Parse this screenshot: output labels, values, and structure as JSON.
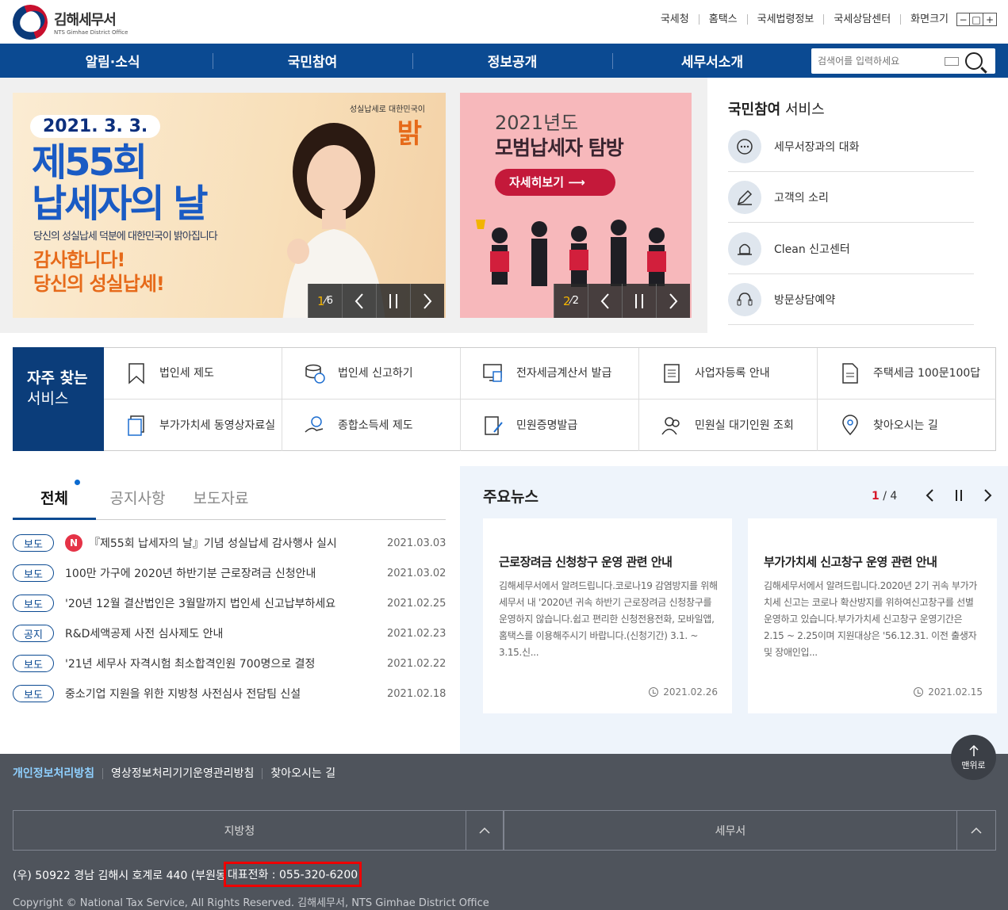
{
  "header": {
    "logo_title": "김해세무서",
    "logo_sub": "NTS Gimhae District Office",
    "util_links": [
      "국세청",
      "홈택스",
      "국세법령정보",
      "국세상담센터",
      "화면크기"
    ],
    "size_controls": [
      "−",
      "□",
      "+"
    ]
  },
  "nav": {
    "items": [
      "알림·소식",
      "국민참여",
      "정보공개",
      "세무서소개"
    ],
    "search_placeholder": "검색어를 입력하세요"
  },
  "hero": {
    "slide1": {
      "date": "2021. 3. 3.",
      "title_line1": "제55회",
      "title_line2": "납세자의 날",
      "subtitle": "당신의 성실납세 덕분에 대한민국이 밝아집니다",
      "thanks_line1": "감사합니다!",
      "thanks_line2": "당신의 성실납세!",
      "brand": "성실납세로 대한민국이",
      "brand_big": "밝"
    },
    "slide1_counter": {
      "current": "1",
      "total": "6"
    },
    "slide2": {
      "year": "2021년도",
      "title": "모범납세자 탐방",
      "button": "자세히보기"
    },
    "slide2_counter": {
      "current": "2",
      "total": "2"
    }
  },
  "citizen_service": {
    "title_bold": "국민참여",
    "title_rest": " 서비스",
    "items": [
      "세무서장과의 대화",
      "고객의 소리",
      "Clean 신고센터",
      "방문상담예약"
    ]
  },
  "quick": {
    "title_bold": "자주 찾는",
    "title_rest": "서비스",
    "items": [
      {
        "label": "법인세 제도"
      },
      {
        "label": "법인세 신고하기"
      },
      {
        "label": "전자세금계산서 발급"
      },
      {
        "label": "사업자등록 안내"
      },
      {
        "label": "주택세금 100문100답"
      },
      {
        "label": "부가가치세 동영상자료실"
      },
      {
        "label": "종합소득세 제도"
      },
      {
        "label": "민원증명발급"
      },
      {
        "label": "민원실 대기인원 조회"
      },
      {
        "label": "찾아오시는 길"
      }
    ]
  },
  "notices": {
    "tabs": [
      "전체",
      "공지사항",
      "보도자료"
    ],
    "rows": [
      {
        "badge": "보도",
        "new": "N",
        "title": "『제55회 납세자의 날』기념 성실납세 감사행사 실시",
        "date": "2021.03.03"
      },
      {
        "badge": "보도",
        "new": "",
        "title": "100만 가구에 2020년 하반기분 근로장려금 신청안내",
        "date": "2021.03.02"
      },
      {
        "badge": "보도",
        "new": "",
        "title": "'20년 12월 결산법인은 3월말까지 법인세 신고납부하세요",
        "date": "2021.02.25"
      },
      {
        "badge": "공지",
        "new": "",
        "title": "R&D세액공제 사전 심사제도 안내",
        "date": "2021.02.23"
      },
      {
        "badge": "보도",
        "new": "",
        "title": "'21년 세무사 자격시험 최소합격인원 700명으로 결정",
        "date": "2021.02.22"
      },
      {
        "badge": "보도",
        "new": "",
        "title": "중소기업 지원을 위한 지방청 사전심사 전담팀 신설",
        "date": "2021.02.18"
      }
    ]
  },
  "news": {
    "title": "주요뉴스",
    "page_current": "1",
    "page_total": "4",
    "cards": [
      {
        "title": "근로장려금 신청창구 운영 관련 안내",
        "body": "김해세무서에서 알려드립니다.코로나19 감염방지를 위해 세무서 내 '2020년 귀속 하반기 근로장려금 신청창구를 운영하지 않습니다.쉽고 편리한 신청전용전화, 모바일앱, 홈택스를 이용해주시기 바랍니다.(신청기간) 3.1. ~ 3.15.신...",
        "date": "2021.02.26"
      },
      {
        "title": "부가가치세 신고창구 운영 관련 안내",
        "body": "김해세무서에서 알려드립니다.2020년 2기 귀속 부가가치세 신고는 코로나 확산방지를 위하여신고창구를 선별 운영하고 있습니다.부가가치세 신고창구 운영기간은 2.15 ~ 2.25이며 지원대상은 '56.12.31. 이전 출생자 및 장애인입...",
        "date": "2021.02.15"
      }
    ]
  },
  "footer": {
    "links": [
      "개인정보처리방침",
      "영상정보처리기기운영관리방침",
      "찾아오시는 길"
    ],
    "select1": "지방청",
    "select2": "세무서",
    "address": "(우) 50922 경남 김해시 호계로 440 (부원동)",
    "tel": "대표전화 : 055-320-6200",
    "copyright": "Copyright © National Tax Service, All Rights Reserved. 김해세무서, NTS Gimhae District Office",
    "to_top": "맨위로"
  },
  "colors": {
    "primary": "#0b4a92",
    "dark_blue": "#0b3d7a",
    "footer": "#4f545c",
    "accent_red": "#d6192a"
  }
}
